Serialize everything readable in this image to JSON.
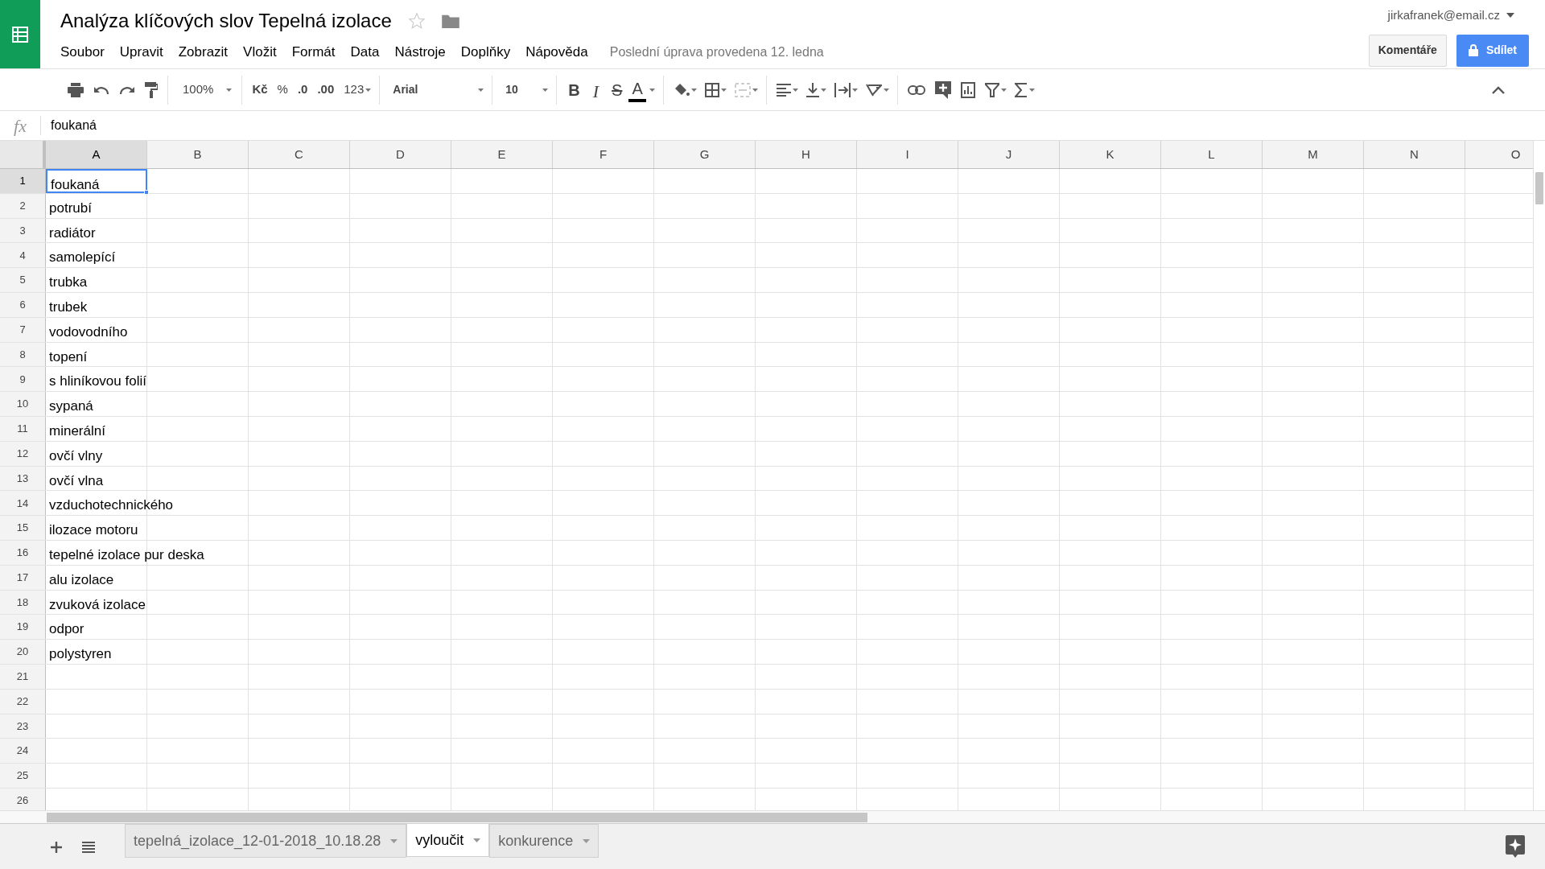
{
  "document": {
    "title": "Analýza klíčových slov Tepelná izolace",
    "starred": false
  },
  "menu": [
    "Soubor",
    "Upravit",
    "Zobrazit",
    "Vložit",
    "Formát",
    "Data",
    "Nástroje",
    "Doplňky",
    "Nápověda"
  ],
  "last_edit": "Poslední úprava provedena 12. ledna",
  "account": "jirkafranek@email.cz",
  "buttons": {
    "comments": "Komentáře",
    "share": "Sdílet"
  },
  "toolbar": {
    "zoom": "100%",
    "currency": "Kč",
    "percent": "%",
    "decrease_decimals": ".0",
    "increase_decimals": ".00",
    "number_format": "123",
    "font": "Arial",
    "font_size": "10",
    "bold": "B",
    "italic": "I",
    "strikethrough": "S",
    "text_color": "A"
  },
  "formula_bar": {
    "label": "fx",
    "value": "foukaná"
  },
  "columns": [
    {
      "label": "A",
      "selected": true
    },
    {
      "label": "B",
      "selected": false
    },
    {
      "label": "C",
      "selected": false
    },
    {
      "label": "D",
      "selected": false
    },
    {
      "label": "E",
      "selected": false
    },
    {
      "label": "F",
      "selected": false
    },
    {
      "label": "G",
      "selected": false
    },
    {
      "label": "H",
      "selected": false
    },
    {
      "label": "I",
      "selected": false
    },
    {
      "label": "J",
      "selected": false
    },
    {
      "label": "K",
      "selected": false
    },
    {
      "label": "L",
      "selected": false
    },
    {
      "label": "M",
      "selected": false
    },
    {
      "label": "N",
      "selected": false
    },
    {
      "label": "O",
      "selected": false
    }
  ],
  "rows": [
    {
      "number": "1",
      "value": "foukaná",
      "selected": true
    },
    {
      "number": "2",
      "value": "potrubí",
      "selected": false
    },
    {
      "number": "3",
      "value": "radiátor",
      "selected": false
    },
    {
      "number": "4",
      "value": "samolepící",
      "selected": false
    },
    {
      "number": "5",
      "value": "trubka",
      "selected": false
    },
    {
      "number": "6",
      "value": "trubek",
      "selected": false
    },
    {
      "number": "7",
      "value": "vodovodního",
      "selected": false
    },
    {
      "number": "8",
      "value": "topení",
      "selected": false
    },
    {
      "number": "9",
      "value": "s hliníkovou folií",
      "selected": false
    },
    {
      "number": "10",
      "value": "sypaná",
      "selected": false
    },
    {
      "number": "11",
      "value": "minerální",
      "selected": false
    },
    {
      "number": "12",
      "value": "ovčí vlny",
      "selected": false
    },
    {
      "number": "13",
      "value": "ovčí vlna",
      "selected": false
    },
    {
      "number": "14",
      "value": "vzduchotechnického",
      "selected": false
    },
    {
      "number": "15",
      "value": "ilozace motoru",
      "selected": false
    },
    {
      "number": "16",
      "value": "tepelné izolace pur deska",
      "selected": false
    },
    {
      "number": "17",
      "value": "alu izolace",
      "selected": false
    },
    {
      "number": "18",
      "value": "zvuková izolace",
      "selected": false
    },
    {
      "number": "19",
      "value": "odpor",
      "selected": false
    },
    {
      "number": "20",
      "value": "polystyren",
      "selected": false
    },
    {
      "number": "21",
      "selected": false
    },
    {
      "number": "22",
      "selected": false
    },
    {
      "number": "23",
      "selected": false
    },
    {
      "number": "24",
      "selected": false
    },
    {
      "number": "25",
      "selected": false
    },
    {
      "number": "26",
      "selected": false
    }
  ],
  "sheets": [
    {
      "label": "tepelná_izolace_12-01-2018_10.18.28",
      "selected": false
    },
    {
      "label": "vyloučit",
      "selected": true
    },
    {
      "label": "konkurence",
      "selected": false
    }
  ]
}
